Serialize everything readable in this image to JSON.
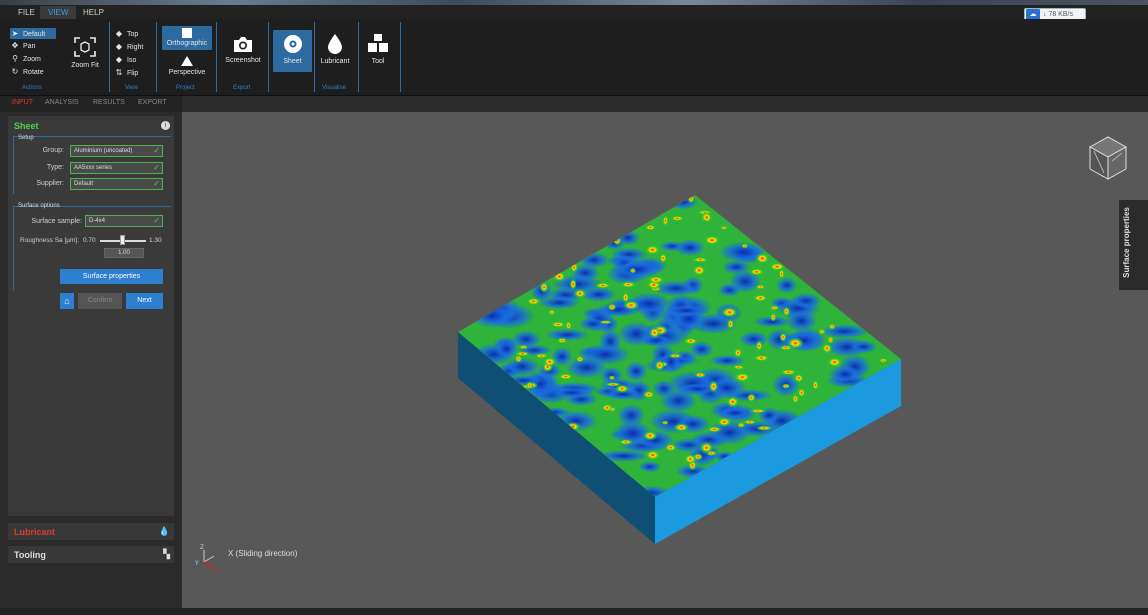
{
  "menubar": {
    "items": [
      "FILE",
      "VIEW",
      "HELP"
    ],
    "active": "VIEW"
  },
  "perf_widget": {
    "icon": "cloud-icon",
    "text": "↓ 78 KB/s"
  },
  "ribbon": {
    "actions": {
      "default": "Default",
      "pan": "Pan",
      "zoom": "Zoom",
      "rotate": "Rotate",
      "zoom_fit": "Zoom Fit",
      "group": "Actions"
    },
    "view": {
      "top": "Top",
      "right": "Right",
      "iso": "Iso",
      "flip": "Flip",
      "group": "View"
    },
    "project": {
      "orthographic": "Orthographic",
      "perspective": "Perspective",
      "group": "Project"
    },
    "export": {
      "screenshot": "Screenshot",
      "group": "Export"
    },
    "visualise": {
      "sheet": "Sheet",
      "lubricant": "Lubricant",
      "tool": "Tool",
      "group": "Visualise"
    }
  },
  "tabs": [
    "INPUT",
    "ANALYSIS",
    "RESULTS",
    "EXPORT"
  ],
  "sheet_panel": {
    "title": "Sheet",
    "setup": {
      "legend": "Setup",
      "group_label": "Group:",
      "group_value": "Aluminium (uncoated)",
      "type_label": "Type:",
      "type_value": "AA5xxx series",
      "supplier_label": "Supplier:",
      "supplier_value": "Default"
    },
    "surface": {
      "legend": "Surface options",
      "sample_label": "Surface sample:",
      "sample_value": "D-4x4",
      "roughness_label": "Roughness Sa [µm]:",
      "roughness_min": "0.70",
      "roughness_max": "1.30",
      "roughness_value": "1.00",
      "slider_fraction": 0.5,
      "properties_button": "Surface properties"
    },
    "buttons": {
      "confirm": "Confirm",
      "next": "Next"
    }
  },
  "accordion": {
    "lubricant": {
      "title": "Lubricant",
      "color": "#e03b2e"
    },
    "tooling": {
      "title": "Tooling",
      "color": "#dddddd"
    }
  },
  "viewport": {
    "axis_label": "X (Sliding direction)",
    "side_tab": "Surface properties",
    "colors": {
      "background": "#585858",
      "block_side_light": "#1c9ae0",
      "block_side_dark": "#0f4f74"
    }
  }
}
